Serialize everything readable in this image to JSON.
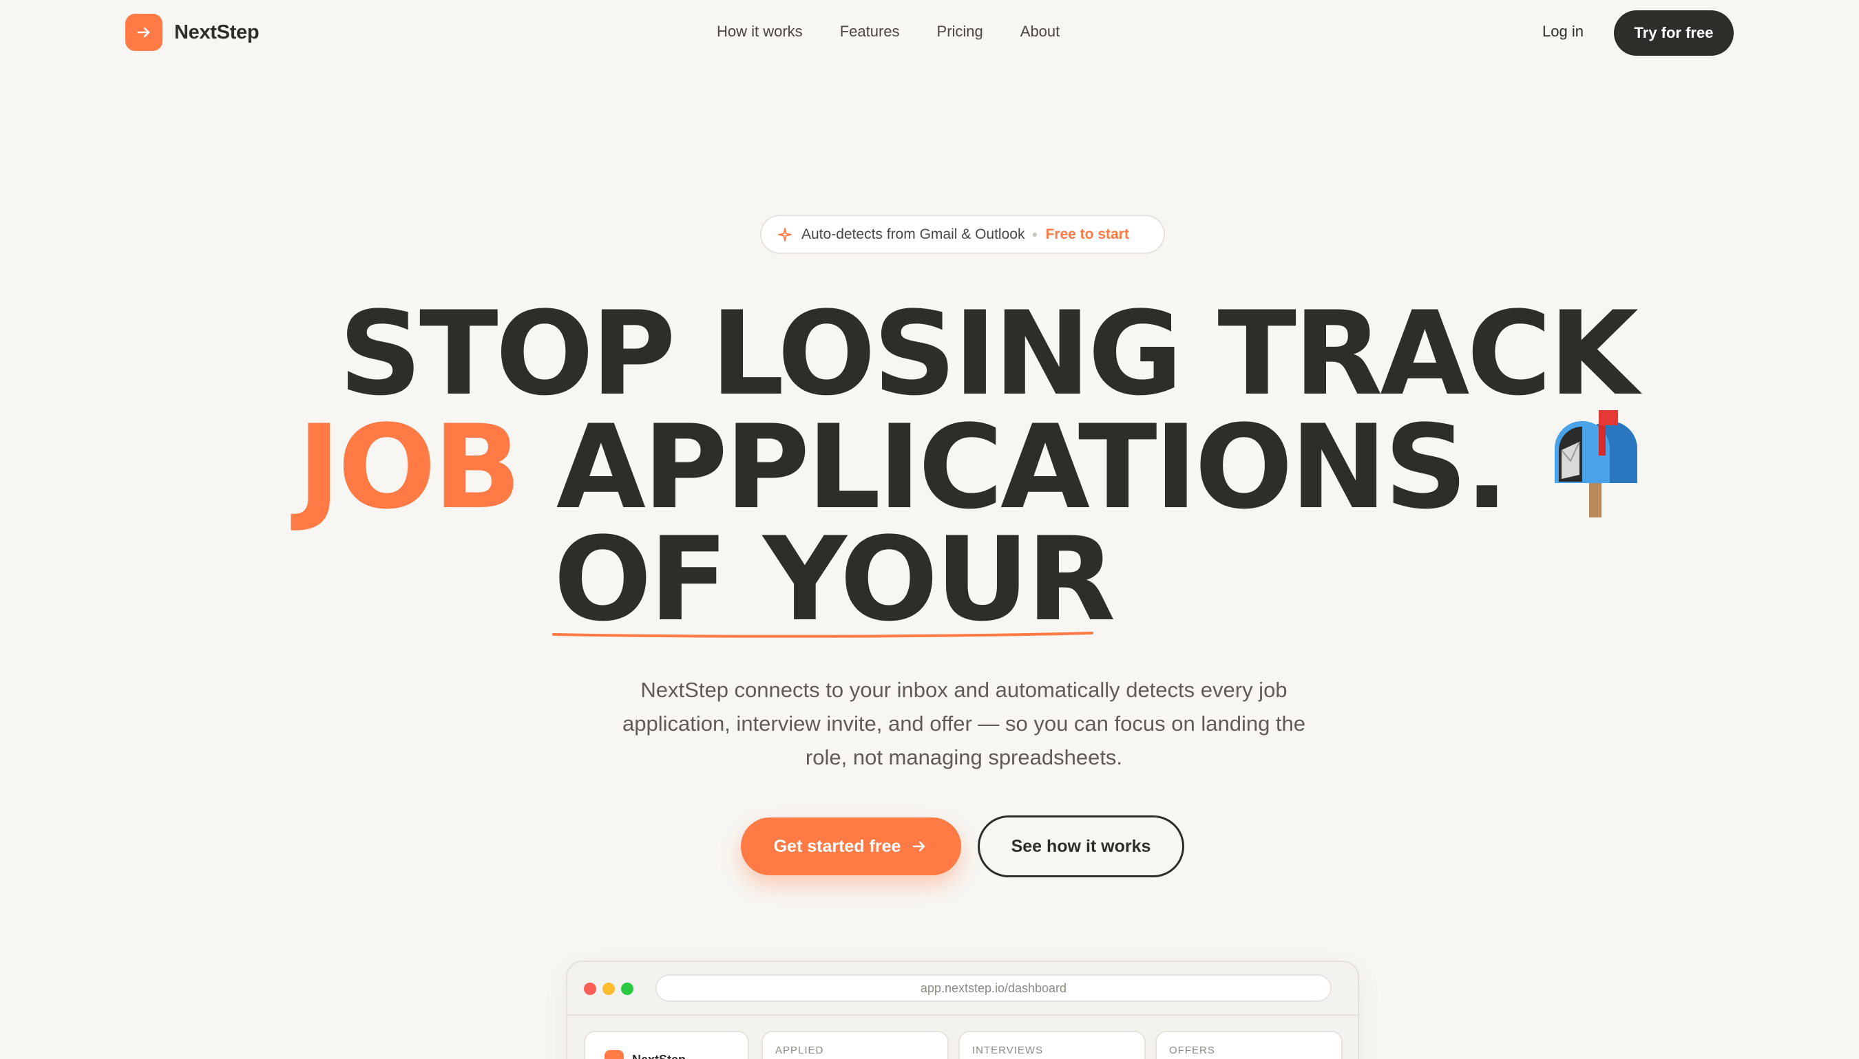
{
  "brand": {
    "name": "NextStep",
    "accent_color": "#ff7a45",
    "dark_color": "#2f2d2a"
  },
  "nav": {
    "links": [
      "How it works",
      "Features",
      "Pricing",
      "About"
    ],
    "login_label": "Log in",
    "cta_label": "Try for free"
  },
  "badge": {
    "icon": "sparkle-icon",
    "text": "Auto-detects from Gmail & Outlook",
    "accent": "Free to start"
  },
  "headline": {
    "line1": "STOP LOSING TRACK",
    "line2_accent": "JOB",
    "line2_rest": "APPLICATIONS.",
    "line2_emoji": "mailbox-icon",
    "line3": "OF YOUR"
  },
  "subtext": "NextStep connects to your inbox and automatically detects every job application, interview invite, and offer — so you can focus on landing the role, not managing spreadsheets.",
  "cta": {
    "primary_label": "Get started free",
    "secondary_label": "See how it works"
  },
  "preview": {
    "url": "app.nextstep.io/dashboard",
    "sidebar_brand": "NextStep",
    "columns": [
      "APPLIED",
      "INTERVIEWS",
      "OFFERS"
    ],
    "window_dot_colors": [
      "#ff5f57",
      "#febc2e",
      "#28c840"
    ]
  }
}
